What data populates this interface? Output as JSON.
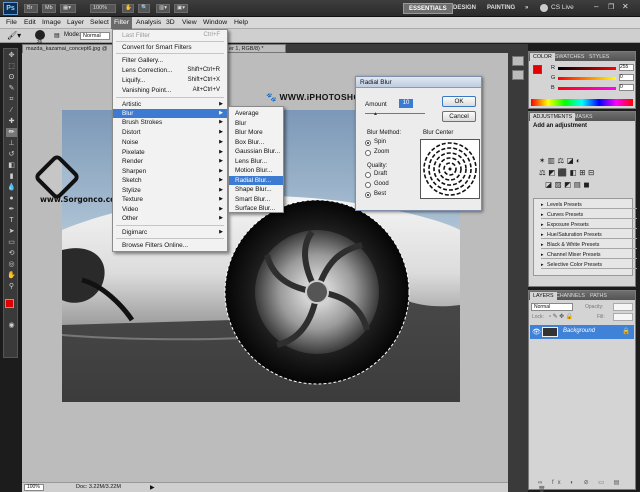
{
  "app": {
    "logo": "Ps",
    "zoom": "100%",
    "workspaces": [
      "ESSENTIALS",
      "DESIGN",
      "PAINTING",
      "»"
    ],
    "cs_live": "CS Live"
  },
  "menubar": [
    "File",
    "Edit",
    "Image",
    "Layer",
    "Select",
    "Filter",
    "Analysis",
    "3D",
    "View",
    "Window",
    "Help"
  ],
  "options_bar": {
    "brush_size": "26",
    "mode_label": "Mode:",
    "mode_value": "Normal"
  },
  "document": {
    "tab": "mazda_kazamai_concept6.jpg @ 100%",
    "tab2": "er 1, RGB/8) *",
    "status_zoom": "100%",
    "status_doc": "Doc: 3.22M/3.22M",
    "watermark_site": "www.Sorgonco.com",
    "watermark_link": "WWW.iPHOTOSHOP.iR"
  },
  "filter_menu": {
    "items": [
      {
        "label": "Last Filter",
        "shortcut": "Ctrl+F",
        "disabled": true
      },
      {
        "label": "Convert for Smart Filters"
      },
      {
        "label": "Filter Gallery..."
      },
      {
        "label": "Lens Correction...",
        "shortcut": "Shift+Ctrl+R"
      },
      {
        "label": "Liquify...",
        "shortcut": "Shift+Ctrl+X"
      },
      {
        "label": "Vanishing Point...",
        "shortcut": "Alt+Ctrl+V"
      },
      {
        "label": "Artistic"
      },
      {
        "label": "Blur",
        "highlighted": true
      },
      {
        "label": "Brush Strokes"
      },
      {
        "label": "Distort"
      },
      {
        "label": "Noise"
      },
      {
        "label": "Pixelate"
      },
      {
        "label": "Render"
      },
      {
        "label": "Sharpen"
      },
      {
        "label": "Sketch"
      },
      {
        "label": "Stylize"
      },
      {
        "label": "Texture"
      },
      {
        "label": "Video"
      },
      {
        "label": "Other"
      },
      {
        "label": "Digimarc"
      },
      {
        "label": "Browse Filters Online..."
      }
    ]
  },
  "blur_submenu": {
    "items": [
      {
        "label": "Average"
      },
      {
        "label": "Blur"
      },
      {
        "label": "Blur More"
      },
      {
        "label": "Box Blur..."
      },
      {
        "label": "Gaussian Blur..."
      },
      {
        "label": "Lens Blur..."
      },
      {
        "label": "Motion Blur..."
      },
      {
        "label": "Radial Blur...",
        "highlighted": true
      },
      {
        "label": "Shape Blur..."
      },
      {
        "label": "Smart Blur..."
      },
      {
        "label": "Surface Blur..."
      }
    ]
  },
  "radial_blur_dialog": {
    "title": "Radial Blur",
    "amount_label": "Amount",
    "amount_value": "10",
    "ok": "OK",
    "cancel": "Cancel",
    "method_label": "Blur Method:",
    "methods": [
      "Spin",
      "Zoom"
    ],
    "selected_method": "Spin",
    "quality_label": "Quality:",
    "qualities": [
      "Draft",
      "Good",
      "Best"
    ],
    "selected_quality": "Best",
    "center_label": "Blur Center"
  },
  "color_panel": {
    "tabs": [
      "COLOR",
      "SWATCHES",
      "STYLES"
    ],
    "r": "255",
    "g": "0",
    "b": "0",
    "labels": [
      "R",
      "G",
      "B"
    ],
    "foreground": "#e00000"
  },
  "adjustments_panel": {
    "tabs": [
      "ADJUSTMENTS",
      "MASKS"
    ],
    "title": "Add an adjustment",
    "presets": [
      "Levels Presets",
      "Curves Presets",
      "Exposure Presets",
      "Hue/Saturation Presets",
      "Black & White Presets",
      "Channel Mixer Presets",
      "Selective Color Presets"
    ]
  },
  "layers_panel": {
    "tabs": [
      "LAYERS",
      "CHANNELS",
      "PATHS"
    ],
    "blend_mode": "Normal",
    "opacity_label": "Opacity:",
    "lock_label": "Lock:",
    "fill_label": "Fill:",
    "layer_name": "Background"
  },
  "colors": {
    "highlight": "#3d7ad1",
    "layer_selected": "#3f82d8"
  }
}
